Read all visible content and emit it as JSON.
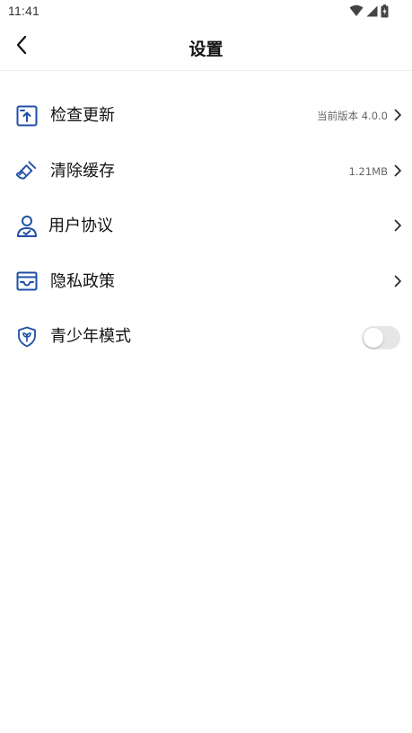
{
  "status_bar": {
    "time": "11:41",
    "icons": [
      "wifi-icon",
      "cell-signal-icon",
      "battery-charging-icon"
    ]
  },
  "header": {
    "title": "设置",
    "back_icon": "chevron-left-icon"
  },
  "colors": {
    "icon_blue": "#1f4fa8",
    "text": "#111111",
    "secondary_text": "#666666",
    "toggle_off": "#e6e6e6",
    "divider": "#ededed"
  },
  "settings": {
    "items": [
      {
        "label": "检查更新",
        "value": "当前版本 4.0.0",
        "icon": "upload-update-icon",
        "trailing": "chevron-right-icon"
      },
      {
        "label": "清除缓存",
        "value": "1.21MB",
        "icon": "broom-icon",
        "trailing": "chevron-right-icon"
      },
      {
        "label": "用户协议",
        "value": "",
        "icon": "user-check-icon",
        "trailing": "chevron-right-icon"
      },
      {
        "label": "隐私政策",
        "value": "",
        "icon": "inbox-tray-icon",
        "trailing": "chevron-right-icon"
      },
      {
        "label": "青少年模式",
        "icon": "shield-leaf-icon",
        "trailing": "toggle",
        "toggle_on": false
      }
    ]
  }
}
